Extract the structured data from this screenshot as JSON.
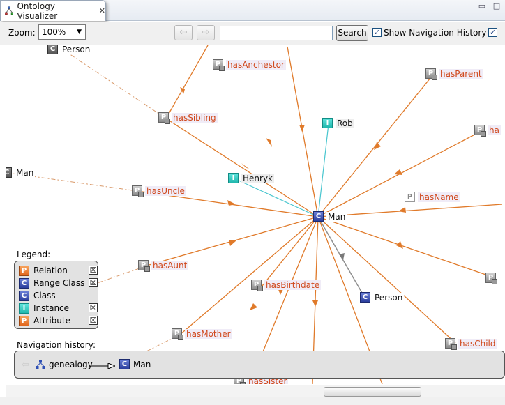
{
  "tab": {
    "title": "Ontology Visualizer",
    "close_glyph": "✕"
  },
  "toolbar": {
    "zoom_label": "Zoom:",
    "zoom_value": "100%",
    "back_glyph": "⇦",
    "forward_glyph": "⇨",
    "search_value": "",
    "search_button": "Search",
    "show_nav_history_label": "Show Navigation History",
    "show_nav_history_checked": true,
    "second_checkbox_checked": true
  },
  "graph": {
    "center": {
      "label": "Man",
      "icon": "C"
    },
    "relations": [
      "hasAnchestor",
      "hasParent",
      "hasSibling",
      "ha",
      "hasUncle",
      "hasName",
      "hasAunt",
      "hasBirthdate",
      "hasMother",
      "hasChild",
      "hasSister"
    ],
    "instances": [
      "Rob",
      "Henryk"
    ],
    "classes": [
      "Person",
      "Person",
      "Man"
    ]
  },
  "legend": {
    "title": "Legend:",
    "items": [
      {
        "label": "Relation",
        "icon": "P",
        "has_toggle": true
      },
      {
        "label": "Range Class",
        "icon": "C",
        "has_toggle": true
      },
      {
        "label": "Class",
        "icon": "C",
        "has_toggle": false
      },
      {
        "label": "Instance",
        "icon": "I",
        "has_toggle": true
      },
      {
        "label": "Attribute",
        "icon": "P",
        "has_toggle": true
      }
    ],
    "toggle_glyph": "☒"
  },
  "navigation": {
    "title": "Navigation history:",
    "items": [
      "genealogy",
      "Man"
    ]
  },
  "colors": {
    "relation_edge": "#e07a2a",
    "instance_edge": "#49c6cf",
    "class_edge": "#8f8f8f",
    "relation_label": "#d0481c",
    "class_icon": "#3450b5",
    "instance_icon": "#2ec7bd"
  }
}
